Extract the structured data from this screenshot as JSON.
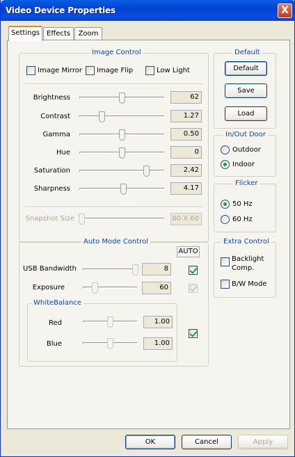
{
  "window": {
    "title": "Video Device Properties",
    "close_glyph": "X"
  },
  "tabs": [
    "Settings",
    "Effects",
    "Zoom"
  ],
  "image_control": {
    "title": "Image Control",
    "checkboxes": [
      {
        "label": "Image Mirror",
        "checked": false
      },
      {
        "label": "Image Flip",
        "checked": false
      },
      {
        "label": "Low Light",
        "checked": false
      }
    ],
    "sliders": [
      {
        "label": "Brightness",
        "value": "62",
        "level": 0.5
      },
      {
        "label": "Contrast",
        "value": "1.27",
        "level": 0.25
      },
      {
        "label": "Gamma",
        "value": "0.50",
        "level": 0.5
      },
      {
        "label": "Hue",
        "value": "0",
        "level": 0.5
      },
      {
        "label": "Saturation",
        "value": "2.42",
        "level": 0.8
      },
      {
        "label": "Sharpness",
        "value": "4.17",
        "level": 0.52
      }
    ],
    "snapshot": {
      "label": "Snapshot Size",
      "value": "80 X 60",
      "level": 0
    }
  },
  "default_group": {
    "title": "Default",
    "buttons": [
      "Default",
      "Save",
      "Load"
    ]
  },
  "inout_door": {
    "title": "In/Out Door",
    "options": [
      {
        "label": "Outdoor",
        "selected": false
      },
      {
        "label": "Indoor",
        "selected": true
      }
    ]
  },
  "flicker": {
    "title": "Flicker",
    "options": [
      {
        "label": "50 Hz",
        "selected": true
      },
      {
        "label": "60 Hz",
        "selected": false
      }
    ]
  },
  "auto_mode": {
    "title": "Auto Mode Control",
    "auto_label": "AUTO",
    "usb": {
      "label": "USB Bandwidth",
      "value": "8",
      "level": 1.0,
      "auto": true
    },
    "exposure": {
      "label": "Exposure",
      "value": "60",
      "level": 0.2,
      "auto": true,
      "auto_disabled": true
    },
    "white_balance": {
      "title": "WhiteBalance",
      "red": {
        "label": "Red",
        "value": "1.00",
        "level": 0.5
      },
      "blue": {
        "label": "Blue",
        "value": "1.00",
        "level": 0.5
      },
      "auto": true
    }
  },
  "extra_control": {
    "title": "Extra Control",
    "checkboxes": [
      {
        "label": "Backlight\nComp.",
        "checked": false
      },
      {
        "label": "B/W Mode",
        "checked": false
      }
    ]
  },
  "footer": {
    "ok": "OK",
    "cancel": "Cancel",
    "apply": "Apply"
  }
}
